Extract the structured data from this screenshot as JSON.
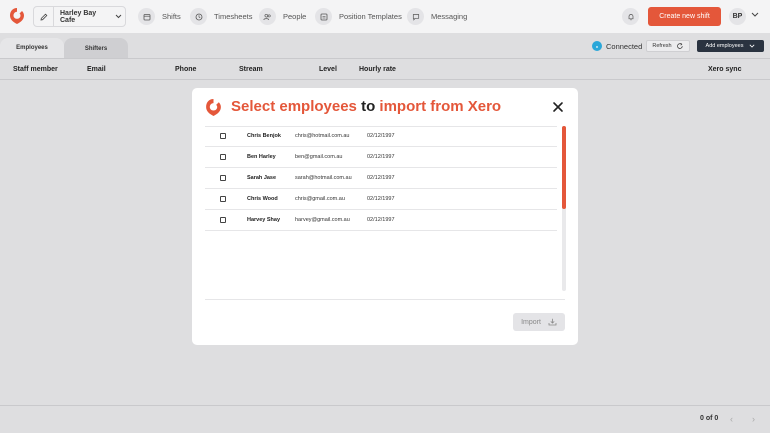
{
  "header": {
    "location_name": "Harley Bay Cafe",
    "nav": [
      {
        "label": "Shifts",
        "icon": "calendar-icon"
      },
      {
        "label": "Timesheets",
        "icon": "clock-icon"
      },
      {
        "label": "People",
        "icon": "people-icon"
      },
      {
        "label": "Position Templates",
        "icon": "template-icon"
      },
      {
        "label": "Messaging",
        "icon": "message-icon"
      }
    ],
    "create_shift_label": "Create new shift",
    "avatar_initials": "BP"
  },
  "tabs": [
    {
      "label": "Employees",
      "active": true
    },
    {
      "label": "Shifters",
      "active": false
    }
  ],
  "toolbar": {
    "connected_label": "Connected",
    "refresh_label": "Refresh",
    "add_employees_label": "Add employees"
  },
  "table": {
    "columns": [
      "Staff member",
      "Email",
      "Phone",
      "Stream",
      "Level",
      "Hourly rate",
      "Xero sync"
    ]
  },
  "pagination": {
    "summary": "0 of 0"
  },
  "modal": {
    "title_part1": "Select employees",
    "title_part2": " to ",
    "title_part3": "import from Xero",
    "rows": [
      {
        "name": "Chris Benjok",
        "email": "chris@hotmail.com.au",
        "date": "02/12/1997",
        "checked": false
      },
      {
        "name": "Ben Harley",
        "email": "ben@gmail.com.au",
        "date": "02/12/1997",
        "checked": false
      },
      {
        "name": "Sarah Jase",
        "email": "sarah@hotmail.com.au",
        "date": "02/12/1997",
        "checked": false
      },
      {
        "name": "Chris Wood",
        "email": "chris@gmail.com.au",
        "date": "02/12/1997",
        "checked": false
      },
      {
        "name": "Harvey Shay",
        "email": "harvey@gmail.com.au",
        "date": "02/12/1997",
        "checked": false
      }
    ],
    "import_label": "Import"
  },
  "colors": {
    "brand": "#e4573a",
    "dark_button": "#2a3340",
    "xero": "#2aa7d9"
  }
}
